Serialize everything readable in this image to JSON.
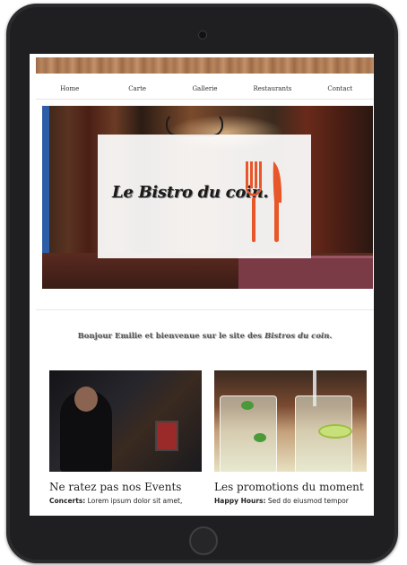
{
  "nav": {
    "items": [
      {
        "label": "Home"
      },
      {
        "label": "Carte"
      },
      {
        "label": "Gallerie"
      },
      {
        "label": "Restaurants"
      },
      {
        "label": "Contact"
      }
    ]
  },
  "hero": {
    "logo_text": "Le Bistro du coin."
  },
  "welcome": {
    "prefix": "Bonjour Emilie et bienvenue sur le site des ",
    "emphasis": "Bistros du coin."
  },
  "cards": [
    {
      "title": "Ne ratez pas nos Events",
      "label": "Concerts:",
      "text": " Lorem ipsum dolor sit amet,"
    },
    {
      "title": "Les promotions du moment",
      "label": "Happy Hours:",
      "text": " Sed do eiusmod tempor"
    }
  ],
  "colors": {
    "device": "#2b2b2d",
    "accent_utensils": "#e8572a"
  }
}
